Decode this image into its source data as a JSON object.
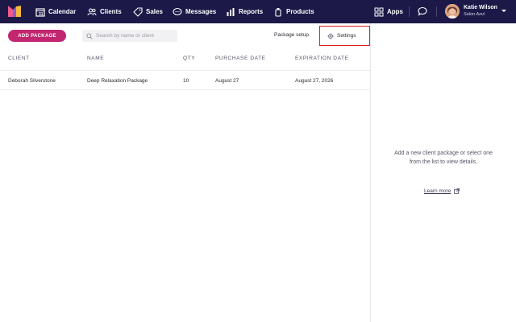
{
  "nav": {
    "items": [
      {
        "label": "Calendar",
        "icon": "calendar-icon"
      },
      {
        "label": "Clients",
        "icon": "clients-icon"
      },
      {
        "label": "Sales",
        "icon": "tag-icon"
      },
      {
        "label": "Messages",
        "icon": "messages-icon"
      },
      {
        "label": "Reports",
        "icon": "chart-icon"
      },
      {
        "label": "Products",
        "icon": "products-icon"
      }
    ],
    "apps_label": "Apps",
    "user": {
      "name": "Katie Wilson",
      "salon": "Salon Azul"
    }
  },
  "toolbar": {
    "add_package": "ADD PACKAGE",
    "search_placeholder": "Search by name or client",
    "package_setup": "Package setup",
    "settings": "Settings"
  },
  "table": {
    "columns": [
      "CLIENT",
      "NAME",
      "QTY",
      "PURCHASE DATE",
      "EXPIRATION DATE"
    ],
    "rows": [
      [
        "Deborah Silverstone",
        "Deep Relaxation Package",
        "10",
        "August 27",
        "August 27, 2026"
      ]
    ]
  },
  "detail": {
    "empty_message": "Add a new client package or select one from the list to view details.",
    "learn_more": "Learn more"
  },
  "colors": {
    "nav_bg": "#1c1948",
    "accent": "#c1266f",
    "highlight": "#e02020"
  }
}
